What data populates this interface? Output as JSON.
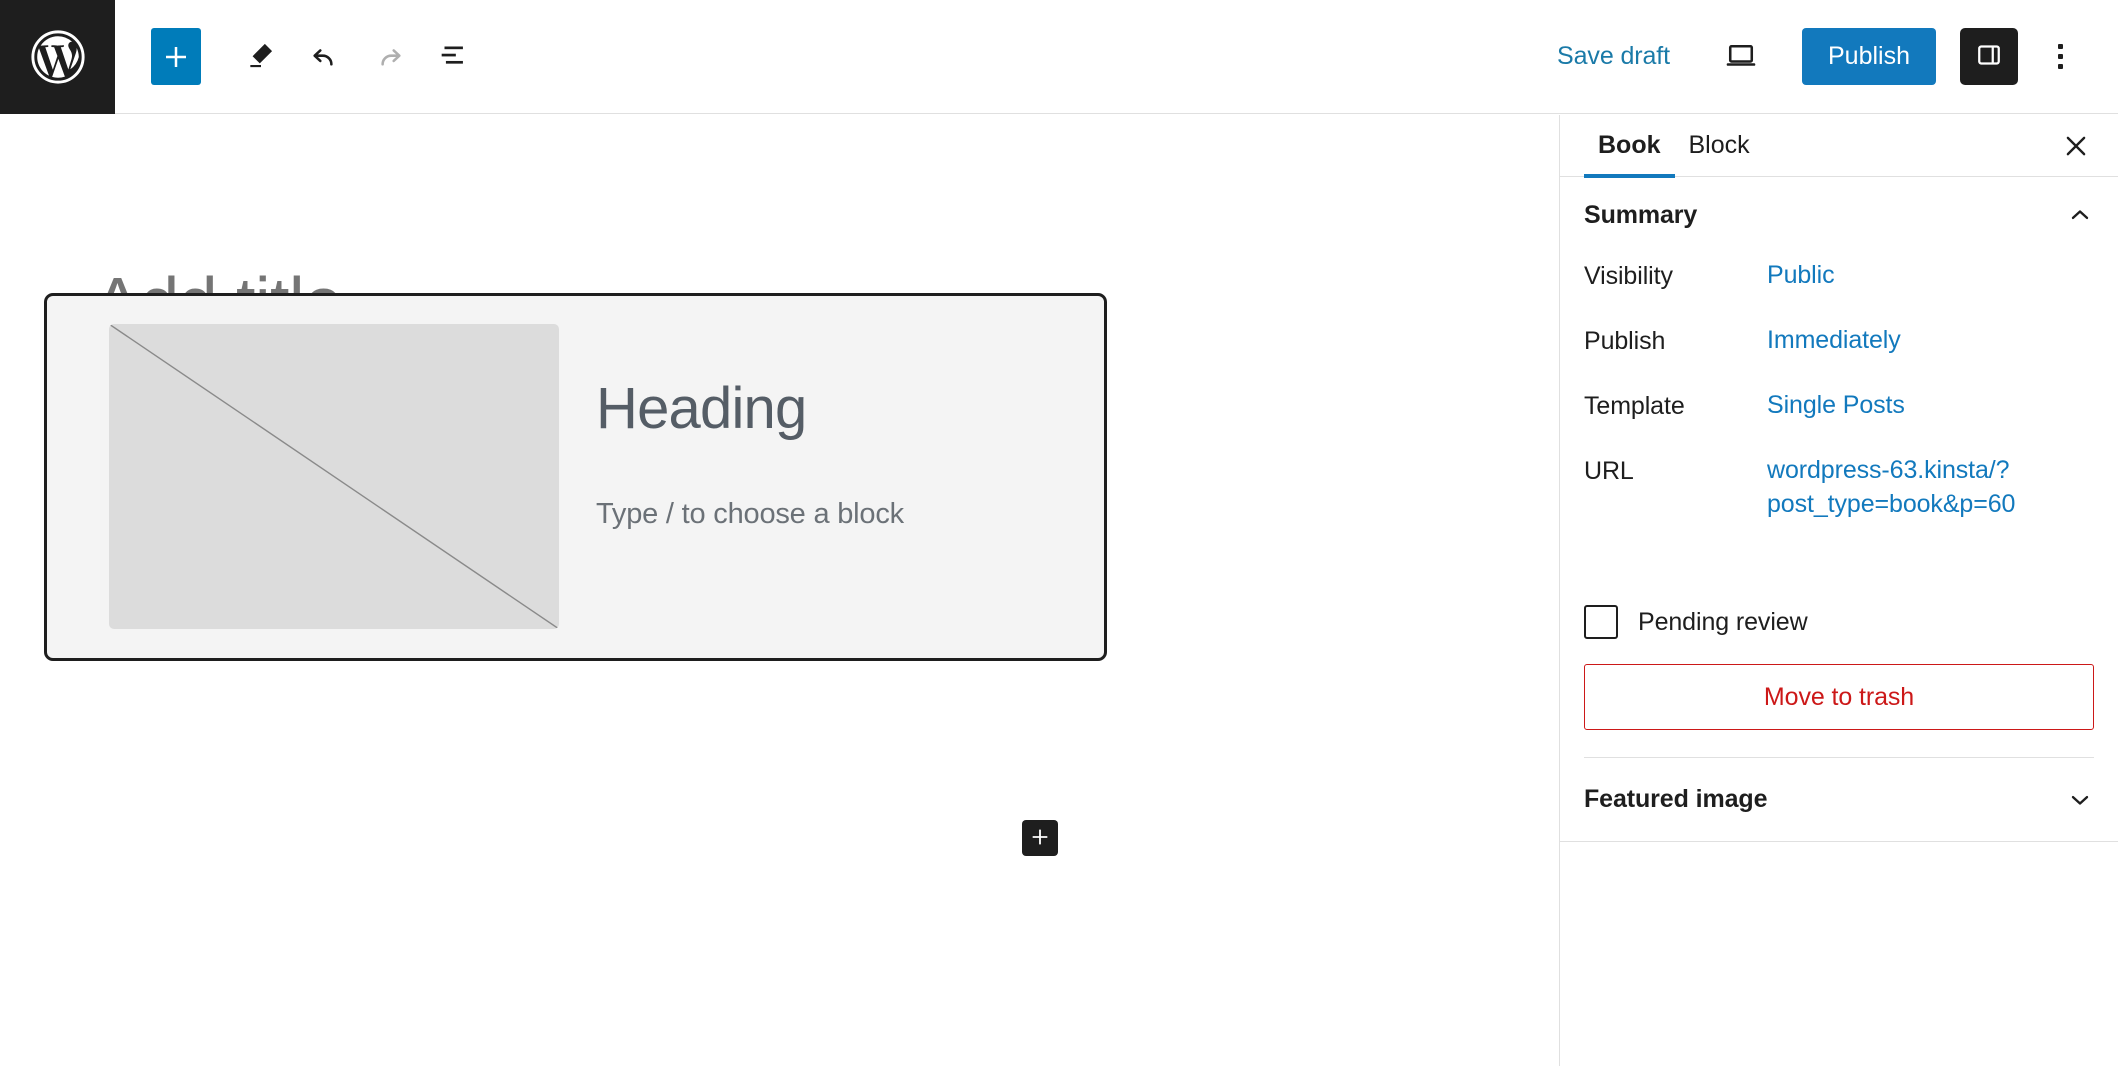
{
  "toolbar": {
    "logo_name": "wordpress-logo",
    "add_block_label": "+",
    "tools_label": "Tools",
    "undo_label": "Undo",
    "redo_label": "Redo",
    "list_view_label": "Document Overview",
    "save_draft_label": "Save draft",
    "preview_label": "Preview",
    "publish_label": "Publish",
    "settings_toggle_label": "Settings",
    "options_label": "Options"
  },
  "editor": {
    "title_placeholder": "Add title",
    "heading_text": "Heading",
    "paragraph_placeholder": "Type / to choose a block",
    "media_placeholder_name": "image-placeholder",
    "appender_label": "+"
  },
  "sidebar": {
    "tabs": [
      {
        "label": "Book",
        "active": true
      },
      {
        "label": "Block",
        "active": false
      }
    ],
    "close_label": "Close settings",
    "summary": {
      "title": "Summary",
      "rows": [
        {
          "label": "Visibility",
          "value": "Public"
        },
        {
          "label": "Publish",
          "value": "Immediately"
        },
        {
          "label": "Template",
          "value": "Single Posts"
        },
        {
          "label": "URL",
          "value": "wordpress-63.kinsta/?post_type=book&p=60"
        }
      ],
      "pending_review_label": "Pending review",
      "pending_review_checked": false,
      "trash_label": "Move to trash"
    },
    "featured_image": {
      "title": "Featured image"
    }
  },
  "colors": {
    "accent_blue": "#1279bd",
    "link_blue": "#1a7aa8",
    "add_block_blue": "#007cba",
    "danger_red": "#cc1818",
    "dark": "#1e1e1e"
  }
}
